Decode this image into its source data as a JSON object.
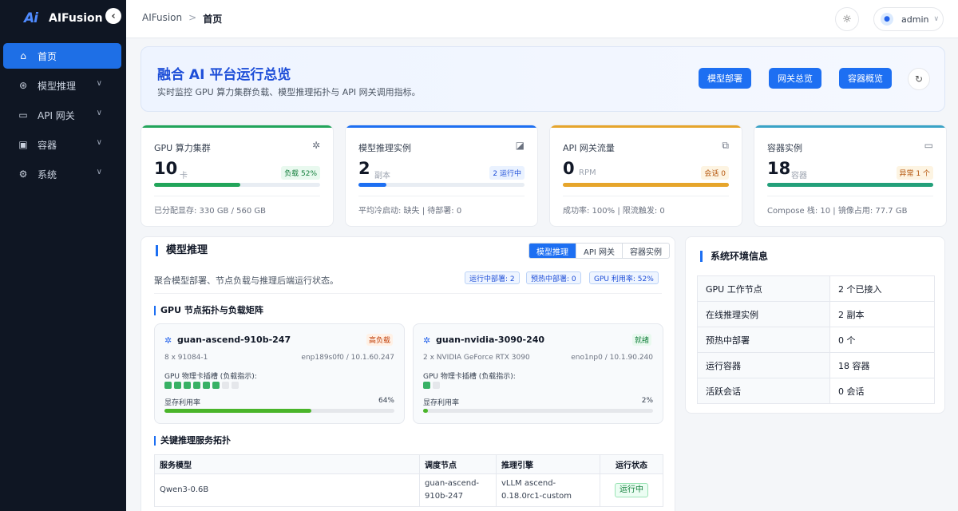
{
  "sidebar": {
    "logo": "Ai",
    "brand": "AIFusion",
    "collapse_glyph": "‹",
    "items": [
      {
        "label": "首页",
        "icon": "home-icon"
      },
      {
        "label": "模型推理",
        "icon": "model-icon"
      },
      {
        "label": "API 网关",
        "icon": "gateway-icon"
      },
      {
        "label": "容器",
        "icon": "container-icon"
      },
      {
        "label": "系统",
        "icon": "gear-icon"
      }
    ]
  },
  "topbar": {
    "breadcrumb_root": "AIFusion",
    "breadcrumb_sep": ">",
    "breadcrumb_current": "首页",
    "user": "admin"
  },
  "hero": {
    "title": "融合 AI 平台运行总览",
    "subtitle": "实时监控 GPU 算力集群负载、模型推理拓扑与 API 网关调用指标。",
    "buttons": [
      "模型部署",
      "网关总览",
      "容器概览"
    ]
  },
  "stats": [
    {
      "label": "GPU 算力集群",
      "value": "10",
      "unit": "卡",
      "badge": "负载 52%",
      "progress": 0.52,
      "footer": "已分配显存: 330 GB / 560 GB",
      "color": "#22a55a"
    },
    {
      "label": "模型推理实例",
      "value": "2",
      "unit": "副本",
      "badge": "2 运行中",
      "progress": 0.17,
      "footer": "平均冷启动: 缺失 | 待部署: 0",
      "color": "#1d6ff2"
    },
    {
      "label": "API 网关流量",
      "value": "0",
      "unit": "RPM",
      "badge": "会话 0",
      "progress": 1.0,
      "footer": "成功率: 100% | 限流触发: 0",
      "color": "#e6a52b"
    },
    {
      "label": "容器实例",
      "value": "18",
      "unit": "容器",
      "badge": "异常 1 个",
      "progress": 1.0,
      "footer": "Compose 栈: 10 | 镜像占用: 77.7 GB",
      "color": "#23a07a"
    }
  ],
  "panel": {
    "title": "模型推理",
    "tabs": [
      "模型推理",
      "API 网关",
      "容器实例"
    ],
    "desc": "聚合模型部署、节点负载与推理后端运行状态。",
    "chips": [
      "运行中部署: 2",
      "预热中部署: 0",
      "GPU 利用率: 52%"
    ],
    "topology_title": "GPU 节点拓扑与负载矩阵",
    "slot_label": "GPU 物理卡插槽 (负载指示):",
    "mem_label": "显存利用率",
    "nodes": [
      {
        "name": "guan-ascend-910b-247",
        "badge": "高负载",
        "model": "8 x 91084-1",
        "net": "enp189s0f0 / 10.1.60.247",
        "slots_on": 6,
        "slots_total": 8,
        "mem_pct": "64%",
        "mem": 0.64
      },
      {
        "name": "guan-nvidia-3090-240",
        "badge": "就绪",
        "model": "2 x NVIDIA GeForce RTX 3090",
        "net": "eno1np0 / 10.1.90.240",
        "slots_on": 1,
        "slots_total": 2,
        "mem_pct": "2%",
        "mem": 0.02
      }
    ],
    "service_title": "关键推理服务拓扑",
    "table": {
      "headers": [
        "服务模型",
        "调度节点",
        "推理引擎",
        "运行状态"
      ],
      "rows": [
        {
          "model": "Qwen3-0.6B",
          "node": "guan-ascend-910b-247",
          "engine": "vLLM ascend-0.18.0rc1-custom",
          "status": "运行中"
        }
      ]
    }
  },
  "env": {
    "title": "系统环境信息",
    "rows": [
      {
        "k": "GPU 工作节点",
        "v": "2 个已接入"
      },
      {
        "k": "在线推理实例",
        "v": "2 副本"
      },
      {
        "k": "预热中部署",
        "v": "0 个"
      },
      {
        "k": "运行容器",
        "v": "18 容器"
      },
      {
        "k": "活跃会话",
        "v": "0 会话"
      }
    ]
  }
}
